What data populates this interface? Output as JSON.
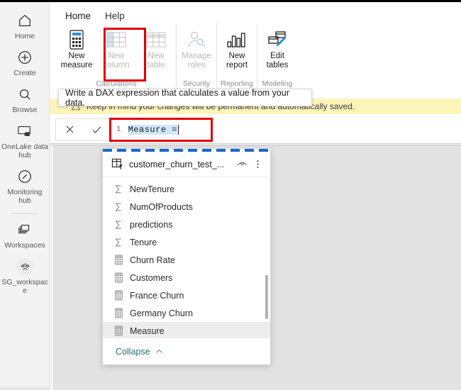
{
  "sidebar": {
    "items": [
      {
        "label": "Home",
        "icon": "home-icon"
      },
      {
        "label": "Create",
        "icon": "plus-circle-icon"
      },
      {
        "label": "Browse",
        "icon": "browse-icon"
      },
      {
        "label": "OneLake data hub",
        "icon": "onelake-data-hub-icon"
      },
      {
        "label": "Monitoring hub",
        "icon": "monitoring-hub-icon"
      },
      {
        "label": "Workspaces",
        "icon": "workspaces-icon"
      },
      {
        "label": "SG_workspace",
        "icon": "workspace-group-icon"
      }
    ]
  },
  "ribbon": {
    "tabs": [
      {
        "label": "Home",
        "active": true
      },
      {
        "label": "Help",
        "active": false
      }
    ],
    "groups": [
      {
        "label": "Calculations",
        "buttons": [
          {
            "label_line1": "New",
            "label_line2": "measure",
            "icon": "calculator-icon",
            "disabled": false
          },
          {
            "label_line1": "New",
            "label_line2": "column",
            "icon": "table-column-icon",
            "disabled": true
          },
          {
            "label_line1": "New",
            "label_line2": "table",
            "icon": "table-icon",
            "disabled": true
          }
        ]
      },
      {
        "label": "Security",
        "buttons": [
          {
            "label_line1": "Manage",
            "label_line2": "roles",
            "icon": "manage-roles-icon",
            "disabled": true
          }
        ]
      },
      {
        "label": "Reporting",
        "buttons": [
          {
            "label_line1": "New",
            "label_line2": "report",
            "icon": "bar-chart-icon",
            "disabled": false
          }
        ]
      },
      {
        "label": "Modeling",
        "buttons": [
          {
            "label_line1": "Edit",
            "label_line2": "tables",
            "icon": "edit-tables-icon",
            "disabled": false
          }
        ]
      }
    ]
  },
  "tooltip": {
    "text": "Write a DAX expression that calculates a value from your data."
  },
  "banner": {
    "icon": "warning-icon",
    "text": "Keep in mind your changes will be permanent and automatically saved."
  },
  "formula_bar": {
    "cancel_icon": "close-icon",
    "accept_icon": "checkmark-icon",
    "line_number": "1",
    "value": "Measure =",
    "selected": true
  },
  "dropdown": {
    "title": "customer_churn_test_...",
    "eye_icon": "eye-icon",
    "more_icon": "more-vertical-icon",
    "items": [
      {
        "label": "NewTenure",
        "icon": "sigma-icon",
        "selected": false
      },
      {
        "label": "NumOfProducts",
        "icon": "sigma-icon",
        "selected": false
      },
      {
        "label": "predictions",
        "icon": "sigma-icon",
        "selected": false
      },
      {
        "label": "Tenure",
        "icon": "sigma-icon",
        "selected": false
      },
      {
        "label": "Churn Rate",
        "icon": "calculator-icon",
        "selected": false
      },
      {
        "label": "Customers",
        "icon": "calculator-icon",
        "selected": false
      },
      {
        "label": "France Churn",
        "icon": "calculator-icon",
        "selected": false
      },
      {
        "label": "Germany Churn",
        "icon": "calculator-icon",
        "selected": false
      },
      {
        "label": "Measure",
        "icon": "calculator-icon",
        "selected": true
      }
    ],
    "collapse_label": "Collapse",
    "collapse_icon": "chevron-up-icon"
  },
  "colors": {
    "accent_teal": "#0e6b5c",
    "highlight_red": "#e00000",
    "banner_yellow": "#fdf4ba",
    "selection_blue": "#cfe6fb",
    "dashed_blue": "#1668c8"
  }
}
